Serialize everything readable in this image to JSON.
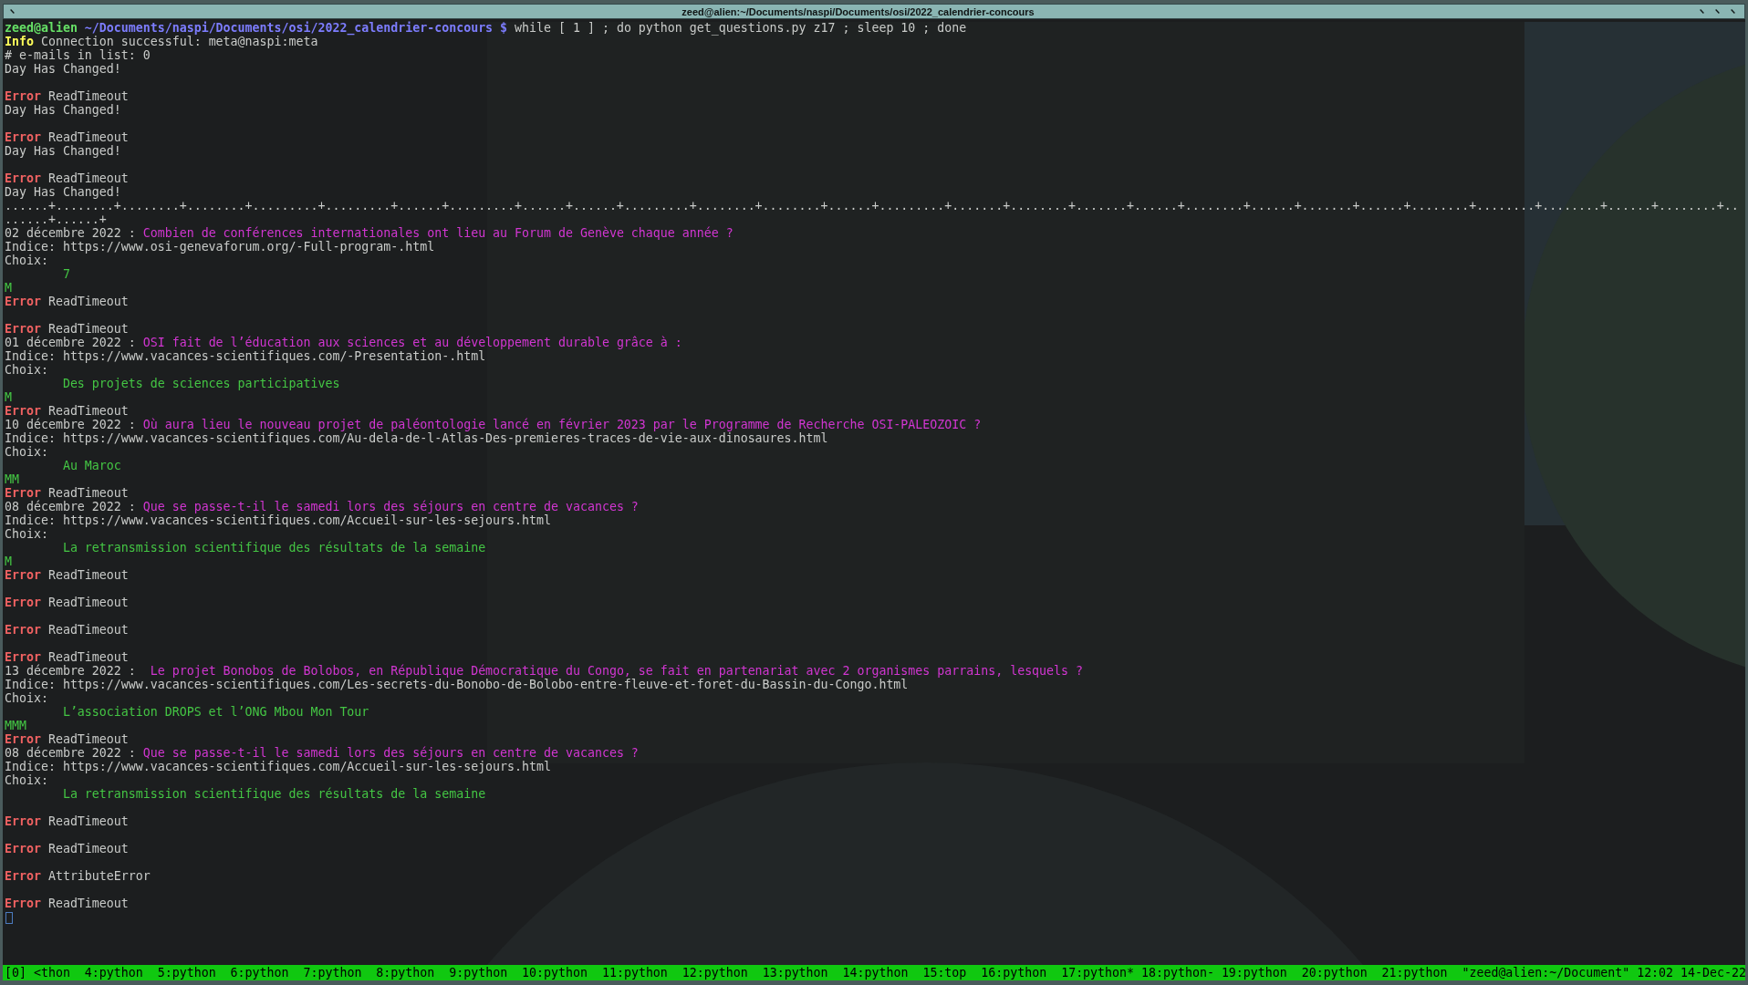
{
  "window": {
    "title": "zeed@alien:~/Documents/naspi/Documents/osi/2022_calendrier-concours"
  },
  "terminal": {
    "lines": [
      {
        "kind": "prompt",
        "user_host": "zeed@alien",
        "cwd": "~/Documents/naspi/Documents/osi/2022_calendrier-concours",
        "symbol": "$",
        "command": "while [ 1 ] ; do python get_questions.py z17 ; sleep 10 ; done"
      },
      {
        "kind": "info",
        "tag": "Info",
        "message": "Connection successful: meta@naspi:meta"
      },
      {
        "kind": "text",
        "text": "# e-mails in list: 0"
      },
      {
        "kind": "text",
        "text": "Day Has Changed!"
      },
      {
        "kind": "blank"
      },
      {
        "kind": "error",
        "tag": "Error",
        "message": "ReadTimeout"
      },
      {
        "kind": "text",
        "text": "Day Has Changed!"
      },
      {
        "kind": "blank"
      },
      {
        "kind": "error",
        "tag": "Error",
        "message": "ReadTimeout"
      },
      {
        "kind": "text",
        "text": "Day Has Changed!"
      },
      {
        "kind": "blank"
      },
      {
        "kind": "error",
        "tag": "Error",
        "message": "ReadTimeout"
      },
      {
        "kind": "text",
        "text": "Day Has Changed!"
      },
      {
        "kind": "text",
        "text": "......+........+........+........+.........+.........+......+.........+......+......+.........+........+........+......+.........+.......+........+.......+......+........+......+.......+......+........+........+........+......+........+.."
      },
      {
        "kind": "text",
        "text": "......+......+"
      },
      {
        "kind": "question",
        "date": "02 décembre 2022 :",
        "question": "Combien de conférences internationales ont lieu au Forum de Genève chaque année ?"
      },
      {
        "kind": "text",
        "text": "Indice: https://www.osi-genevaforum.org/-Full-program-.html"
      },
      {
        "kind": "text",
        "text": "Choix:"
      },
      {
        "kind": "answer",
        "text": "7"
      },
      {
        "kind": "marks",
        "text": "M"
      },
      {
        "kind": "error",
        "tag": "Error",
        "message": "ReadTimeout"
      },
      {
        "kind": "blank"
      },
      {
        "kind": "error",
        "tag": "Error",
        "message": "ReadTimeout"
      },
      {
        "kind": "question",
        "date": "01 décembre 2022 :",
        "question": "OSI fait de l’éducation aux sciences et au développement durable grâce à :"
      },
      {
        "kind": "text",
        "text": "Indice: https://www.vacances-scientifiques.com/-Presentation-.html"
      },
      {
        "kind": "text",
        "text": "Choix:"
      },
      {
        "kind": "answer",
        "text": "Des projets de sciences participatives"
      },
      {
        "kind": "marks",
        "text": "M"
      },
      {
        "kind": "error",
        "tag": "Error",
        "message": "ReadTimeout"
      },
      {
        "kind": "question",
        "date": "10 décembre 2022 :",
        "question": "Où aura lieu le nouveau projet de paléontologie lancé en février 2023 par le Programme de Recherche OSI-PALEOZOIC ?"
      },
      {
        "kind": "text",
        "text": "Indice: https://www.vacances-scientifiques.com/Au-dela-de-l-Atlas-Des-premieres-traces-de-vie-aux-dinosaures.html"
      },
      {
        "kind": "text",
        "text": "Choix:"
      },
      {
        "kind": "answer",
        "text": "Au Maroc"
      },
      {
        "kind": "marks",
        "text": "MM"
      },
      {
        "kind": "error",
        "tag": "Error",
        "message": "ReadTimeout"
      },
      {
        "kind": "question",
        "date": "08 décembre 2022 :",
        "question": "Que se passe-t-il le samedi lors des séjours en centre de vacances ?"
      },
      {
        "kind": "text",
        "text": "Indice: https://www.vacances-scientifiques.com/Accueil-sur-les-sejours.html"
      },
      {
        "kind": "text",
        "text": "Choix:"
      },
      {
        "kind": "answer",
        "text": "La retransmission scientifique des résultats de la semaine"
      },
      {
        "kind": "marks",
        "text": "M"
      },
      {
        "kind": "error",
        "tag": "Error",
        "message": "ReadTimeout"
      },
      {
        "kind": "blank"
      },
      {
        "kind": "error",
        "tag": "Error",
        "message": "ReadTimeout"
      },
      {
        "kind": "blank"
      },
      {
        "kind": "error",
        "tag": "Error",
        "message": "ReadTimeout"
      },
      {
        "kind": "blank"
      },
      {
        "kind": "error",
        "tag": "Error",
        "message": "ReadTimeout"
      },
      {
        "kind": "question",
        "date": "13 décembre 2022 :",
        "question": " Le projet Bonobos de Bolobos, en République Démocratique du Congo, se fait en partenariat avec 2 organismes parrains, lesquels ?"
      },
      {
        "kind": "text",
        "text": "Indice: https://www.vacances-scientifiques.com/Les-secrets-du-Bonobo-de-Bolobo-entre-fleuve-et-foret-du-Bassin-du-Congo.html"
      },
      {
        "kind": "text",
        "text": "Choix:"
      },
      {
        "kind": "answer",
        "text": "L’association DROPS et l’ONG Mbou Mon Tour"
      },
      {
        "kind": "marks",
        "text": "MMM"
      },
      {
        "kind": "error",
        "tag": "Error",
        "message": "ReadTimeout"
      },
      {
        "kind": "question",
        "date": "08 décembre 2022 :",
        "question": "Que se passe-t-il le samedi lors des séjours en centre de vacances ?"
      },
      {
        "kind": "text",
        "text": "Indice: https://www.vacances-scientifiques.com/Accueil-sur-les-sejours.html"
      },
      {
        "kind": "text",
        "text": "Choix:"
      },
      {
        "kind": "answer",
        "text": "La retransmission scientifique des résultats de la semaine"
      },
      {
        "kind": "blank"
      },
      {
        "kind": "error",
        "tag": "Error",
        "message": "ReadTimeout"
      },
      {
        "kind": "blank"
      },
      {
        "kind": "error",
        "tag": "Error",
        "message": "ReadTimeout"
      },
      {
        "kind": "blank"
      },
      {
        "kind": "error",
        "tag": "Error",
        "message": "AttributeError"
      },
      {
        "kind": "blank"
      },
      {
        "kind": "error",
        "tag": "Error",
        "message": "ReadTimeout"
      },
      {
        "kind": "cursor"
      }
    ]
  },
  "status_bar": {
    "session": "[0]",
    "windows": [
      {
        "label": "<thon",
        "kind": "window"
      },
      {
        "label": "4:python",
        "kind": "window"
      },
      {
        "label": "5:python",
        "kind": "window"
      },
      {
        "label": "6:python",
        "kind": "window"
      },
      {
        "label": "7:python",
        "kind": "window"
      },
      {
        "label": "8:python",
        "kind": "window"
      },
      {
        "label": "9:python",
        "kind": "window"
      },
      {
        "label": "10:python",
        "kind": "window"
      },
      {
        "label": "11:python",
        "kind": "window"
      },
      {
        "label": "12:python",
        "kind": "window"
      },
      {
        "label": "13:python",
        "kind": "window"
      },
      {
        "label": "14:python",
        "kind": "window"
      },
      {
        "label": "15:top",
        "kind": "window"
      },
      {
        "label": "16:python",
        "kind": "window"
      },
      {
        "label": "17:python*",
        "kind": "flagged"
      },
      {
        "label": "18:python-",
        "kind": "flagged"
      },
      {
        "label": "19:python",
        "kind": "window"
      },
      {
        "label": "20:python",
        "kind": "window"
      },
      {
        "label": "21:python",
        "kind": "window"
      }
    ],
    "pane_title": "\"zeed@alien:~/Document\"",
    "time": "12:02",
    "date": "14-Dec-22"
  }
}
